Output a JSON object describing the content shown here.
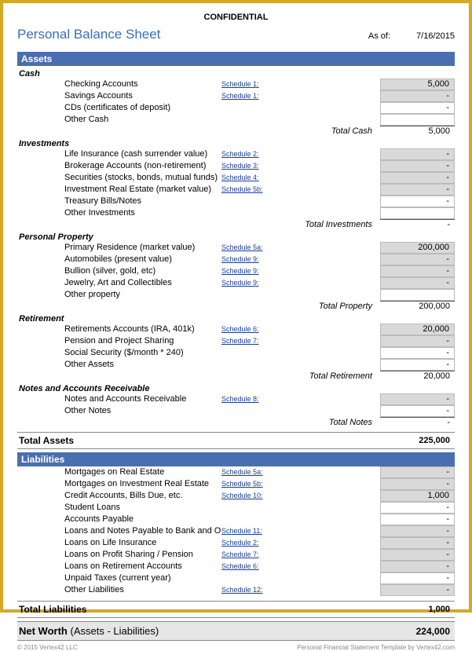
{
  "confidential": "CONFIDENTIAL",
  "title": "Personal Balance Sheet",
  "asof_label": "As of:",
  "asof_date": "7/16/2015",
  "assets": {
    "header": "Assets",
    "cash": {
      "label": "Cash",
      "items": [
        {
          "label": "Checking Accounts",
          "schedule": "Schedule 1:",
          "value": "5,000",
          "gray": true
        },
        {
          "label": "Savings Accounts",
          "schedule": "Schedule 1:",
          "value": "-",
          "gray": true
        },
        {
          "label": "CDs (certificates of deposit)",
          "schedule": "",
          "value": "-",
          "gray": false
        },
        {
          "label": "Other Cash",
          "schedule": "",
          "value": "",
          "gray": false
        }
      ],
      "total_label": "Total Cash",
      "total_value": "5,000"
    },
    "investments": {
      "label": "Investments",
      "items": [
        {
          "label": "Life Insurance (cash surrender value)",
          "schedule": "Schedule 2:",
          "value": "-",
          "gray": true
        },
        {
          "label": "Brokerage Accounts (non-retirement)",
          "schedule": "Schedule 3:",
          "value": "-",
          "gray": true
        },
        {
          "label": "Securities (stocks, bonds, mutual funds)",
          "schedule": "Schedule 4:",
          "value": "-",
          "gray": true
        },
        {
          "label": "Investment Real Estate (market value)",
          "schedule": "Schedule 5b:",
          "value": "-",
          "gray": true
        },
        {
          "label": "Treasury Bills/Notes",
          "schedule": "",
          "value": "-",
          "gray": false
        },
        {
          "label": "Other Investments",
          "schedule": "",
          "value": "",
          "gray": false
        }
      ],
      "total_label": "Total Investments",
      "total_value": "-"
    },
    "property": {
      "label": "Personal Property",
      "items": [
        {
          "label": "Primary Residence (market value)",
          "schedule": "Schedule 5a:",
          "value": "200,000",
          "gray": true
        },
        {
          "label": "Automobiles (present value)",
          "schedule": "Schedule 9:",
          "value": "-",
          "gray": true
        },
        {
          "label": "Bullion (silver, gold, etc)",
          "schedule": "Schedule 9:",
          "value": "-",
          "gray": true
        },
        {
          "label": "Jewelry, Art and Collectibles",
          "schedule": "Schedule 9:",
          "value": "-",
          "gray": true
        },
        {
          "label": "Other property",
          "schedule": "",
          "value": "",
          "gray": false
        }
      ],
      "total_label": "Total Property",
      "total_value": "200,000"
    },
    "retirement": {
      "label": "Retirement",
      "items": [
        {
          "label": "Retirements Accounts (IRA, 401k)",
          "schedule": "Schedule 6:",
          "value": "20,000",
          "gray": true
        },
        {
          "label": "Pension and Project Sharing",
          "schedule": "Schedule 7:",
          "value": "-",
          "gray": true
        },
        {
          "label": "Social Security ($/month * 240)",
          "schedule": "",
          "value": "-",
          "gray": false
        },
        {
          "label": "Other Assets",
          "schedule": "",
          "value": "-",
          "gray": false
        }
      ],
      "total_label": "Total Retirement",
      "total_value": "20,000"
    },
    "notes": {
      "label": "Notes and Accounts Receivable",
      "items": [
        {
          "label": "Notes and Accounts Receivable",
          "schedule": "Schedule 8:",
          "value": "-",
          "gray": true
        },
        {
          "label": "Other Notes",
          "schedule": "",
          "value": "-",
          "gray": false
        }
      ],
      "total_label": "Total Notes",
      "total_value": "-"
    },
    "total_label": "Total Assets",
    "total_value": "225,000"
  },
  "liabilities": {
    "header": "Liabilities",
    "items": [
      {
        "label": "Mortgages on Real Estate",
        "schedule": "Schedule 5a:",
        "value": "-",
        "gray": true
      },
      {
        "label": "Mortgages on Investment Real Estate",
        "schedule": "Schedule 5b:",
        "value": "-",
        "gray": true
      },
      {
        "label": "Credit Accounts, Bills Due, etc.",
        "schedule": "Schedule 10:",
        "value": "1,000",
        "gray": true
      },
      {
        "label": "Student Loans",
        "schedule": "",
        "value": "-",
        "gray": false
      },
      {
        "label": "Accounts Payable",
        "schedule": "",
        "value": "-",
        "gray": false
      },
      {
        "label": "Loans and Notes Payable to Bank and Others",
        "schedule": "Schedule 11:",
        "value": "-",
        "gray": true
      },
      {
        "label": "Loans on Life Insurance",
        "schedule": "Schedule 2:",
        "value": "-",
        "gray": true
      },
      {
        "label": "Loans on Profit Sharing / Pension",
        "schedule": "Schedule 7:",
        "value": "-",
        "gray": true
      },
      {
        "label": "Loans on Retirement Accounts",
        "schedule": "Schedule 6:",
        "value": "-",
        "gray": true
      },
      {
        "label": "Unpaid Taxes (current year)",
        "schedule": "",
        "value": "-",
        "gray": false
      },
      {
        "label": "Other Liabilities",
        "schedule": "Schedule 12:",
        "value": "-",
        "gray": true
      }
    ],
    "total_label": "Total Liabilities",
    "total_value": "1,000"
  },
  "networth": {
    "label_bold": "Net Worth",
    "label_rest": " (Assets - Liabilities)",
    "value": "224,000"
  },
  "footer": {
    "left": "© 2015 Vertex42 LLC",
    "right": "Personal Financial Statement Template by Vertex42.com"
  }
}
